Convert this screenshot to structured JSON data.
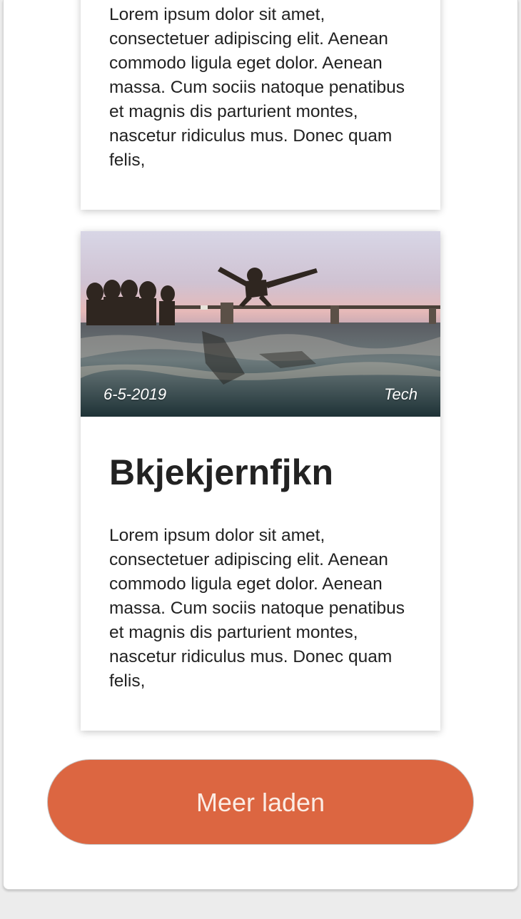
{
  "posts": [
    {
      "excerpt": "Lorem ipsum dolor sit amet, consectetuer adipiscing elit. Aenean commodo ligula eget dolor. Aenean massa. Cum sociis natoque penatibus et magnis dis parturient montes, nascetur ridiculus mus. Donec quam felis,"
    },
    {
      "date": "6-5-2019",
      "category": "Tech",
      "title": "Bkjekjernfjkn",
      "excerpt": "Lorem ipsum dolor sit amet, consectetuer adipiscing elit. Aenean commodo ligula eget dolor. Aenean massa. Cum sociis natoque penatibus et magnis dis parturient montes, nascetur ridiculus mus. Donec quam felis,"
    }
  ],
  "load_more": {
    "label": "Meer laden"
  },
  "colors": {
    "accent": "#dc6641",
    "text": "#222222",
    "background": "#ececec"
  }
}
